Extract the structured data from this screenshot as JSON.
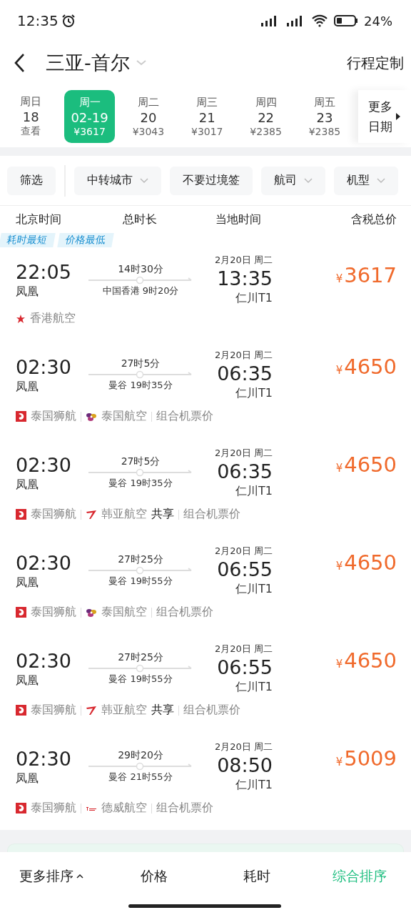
{
  "status_bar": {
    "time": "12:35",
    "battery": "24%"
  },
  "header": {
    "title": "三亚-首尔",
    "action": "行程定制"
  },
  "dates": [
    {
      "weekday": "周日",
      "date": "18",
      "price": "查看",
      "selected": false
    },
    {
      "weekday": "周一",
      "date": "02-19",
      "price": "¥3617",
      "selected": true
    },
    {
      "weekday": "周二",
      "date": "20",
      "price": "¥3043",
      "selected": false
    },
    {
      "weekday": "周三",
      "date": "21",
      "price": "¥3017",
      "selected": false
    },
    {
      "weekday": "周四",
      "date": "22",
      "price": "¥2385",
      "selected": false
    },
    {
      "weekday": "周五",
      "date": "23",
      "price": "¥2385",
      "selected": false
    }
  ],
  "more_dates": [
    "更多",
    "日期"
  ],
  "filters": [
    {
      "label": "筛选",
      "dropdown": false
    },
    {
      "label": "中转城市",
      "dropdown": true
    },
    {
      "label": "不要过境签",
      "dropdown": false
    },
    {
      "label": "航司",
      "dropdown": true
    },
    {
      "label": "机型",
      "dropdown": true
    }
  ],
  "columns": [
    "北京时间",
    "总时长",
    "当地时间",
    "含税总价"
  ],
  "flights": [
    {
      "tags": [
        "耗时最短",
        "价格最低"
      ],
      "depart": "22:05",
      "from": "凤凰",
      "duration": "14时30分",
      "stop": "中国香港  9时20分",
      "arrive_date": "2月20日 周二",
      "arrive": "13:35",
      "to": "仁川T1",
      "currency": "¥",
      "price": "3617",
      "airlines": [
        {
          "kind": "flower",
          "name": "香港航空"
        }
      ]
    },
    {
      "depart": "02:30",
      "from": "凤凰",
      "duration": "27时5分",
      "stop": "曼谷  19时35分",
      "arrive_date": "2月20日 周二",
      "arrive": "06:35",
      "to": "仁川T1",
      "currency": "¥",
      "price": "4650",
      "airlines": [
        {
          "kind": "lion",
          "name": "泰国狮航"
        },
        {
          "kind": "orchid",
          "name": "泰国航空"
        }
      ],
      "note": "组合机票价"
    },
    {
      "depart": "02:30",
      "from": "凤凰",
      "duration": "27时5分",
      "stop": "曼谷  19时35分",
      "arrive_date": "2月20日 周二",
      "arrive": "06:35",
      "to": "仁川T1",
      "currency": "¥",
      "price": "4650",
      "airlines": [
        {
          "kind": "lion",
          "name": "泰国狮航"
        },
        {
          "kind": "swoosh",
          "name": "韩亚航空",
          "share": "共享"
        }
      ],
      "note": "组合机票价"
    },
    {
      "depart": "02:30",
      "from": "凤凰",
      "duration": "27时25分",
      "stop": "曼谷  19时55分",
      "arrive_date": "2月20日 周二",
      "arrive": "06:55",
      "to": "仁川T1",
      "currency": "¥",
      "price": "4650",
      "airlines": [
        {
          "kind": "lion",
          "name": "泰国狮航"
        },
        {
          "kind": "orchid",
          "name": "泰国航空"
        }
      ],
      "note": "组合机票价"
    },
    {
      "depart": "02:30",
      "from": "凤凰",
      "duration": "27时25分",
      "stop": "曼谷  19时55分",
      "arrive_date": "2月20日 周二",
      "arrive": "06:55",
      "to": "仁川T1",
      "currency": "¥",
      "price": "4650",
      "airlines": [
        {
          "kind": "lion",
          "name": "泰国狮航"
        },
        {
          "kind": "swoosh",
          "name": "韩亚航空",
          "share": "共享"
        }
      ],
      "note": "组合机票价"
    },
    {
      "depart": "02:30",
      "from": "凤凰",
      "duration": "29时20分",
      "stop": "曼谷  21时55分",
      "arrive_date": "2月20日 周二",
      "arrive": "08:50",
      "to": "仁川T1",
      "currency": "¥",
      "price": "5009",
      "airlines": [
        {
          "kind": "lion",
          "name": "泰国狮航"
        },
        {
          "kind": "wordmark",
          "name": "德威航空"
        }
      ],
      "note": "组合机票价"
    }
  ],
  "sort_bar": [
    {
      "label": "更多排序",
      "caret": true,
      "selected": false
    },
    {
      "label": "价格",
      "caret": false,
      "selected": false
    },
    {
      "label": "耗时",
      "caret": false,
      "selected": false
    },
    {
      "label": "综合排序",
      "caret": false,
      "selected": true
    }
  ]
}
